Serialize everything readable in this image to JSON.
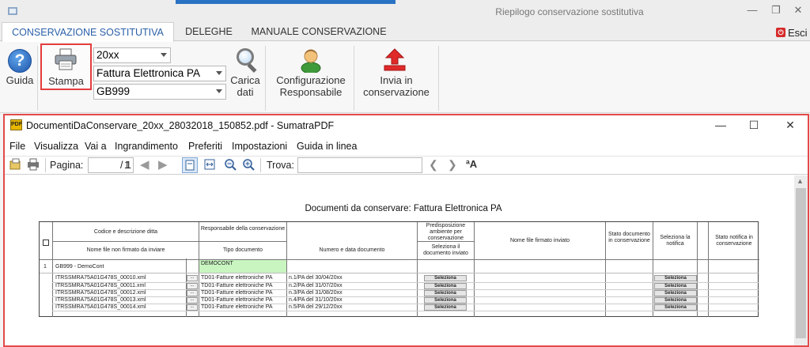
{
  "window": {
    "title": "Riepilogo conservazione sostitutiva"
  },
  "tabs": [
    {
      "label": "CONSERVAZIONE SOSTITUTIVA"
    },
    {
      "label": "DELEGHE"
    },
    {
      "label": "MANUALE CONSERVAZIONE"
    }
  ],
  "exit": {
    "label": "Esci"
  },
  "ribbon": {
    "guida": "Guida",
    "stampa": "Stampa",
    "year": "20xx",
    "doc_type": "Fattura Elettronica PA",
    "company": "GB999",
    "carica_line1": "Carica",
    "carica_line2": "dati",
    "config_line1": "Configurazione",
    "config_line2": "Responsabile",
    "invia_line1": "Invia in",
    "invia_line2": "conservazione"
  },
  "pdf": {
    "title": "DocumentiDaConservare_20xx_28032018_150852.pdf - SumatraPDF",
    "menus": [
      "File",
      "Visualizza",
      "Vai a",
      "Ingrandimento",
      "Preferiti",
      "Impostazioni",
      "Guida in linea"
    ],
    "pagina_label": "Pagina:",
    "page_value": "1",
    "page_total": "/ 1",
    "trova_label": "Trova:",
    "heading": "Documenti da conservare:  Fattura Elettronica PA"
  },
  "table": {
    "h_codice": "Codice e descrizione ditta",
    "h_nome_file": "Nome file non firmato da inviare",
    "h_responsabile": "Responsabile della conservazione",
    "h_tipo": "Tipo documento",
    "h_numero": "Numero e data documento",
    "h_predisposizione": "Predisposizione ambiente per conservazione",
    "h_seleziona_doc": "Seleziona il documento inviato",
    "h_nome_firmato": "Nome file firmato inviato",
    "h_stato_doc": "Stato documento in conservazione",
    "h_seleziona_notifica": "Seleziona la notifica",
    "h_stato_notifica": "Stato notifica in conservazione",
    "group_index": "1",
    "group_company": "GB999 - DemoCont",
    "group_responsabile": "DEMOCONT",
    "button_label": "Seleziona",
    "rows": [
      {
        "file": "ITRSSMRA75A01G478S_00010.xml",
        "dots": "...",
        "tipo": "TD01-Fatture elettroniche PA",
        "numero": "n.1/PA del 30/04/20xx"
      },
      {
        "file": "ITRSSMRA75A01G478S_00011.xml",
        "dots": "...",
        "tipo": "TD01-Fatture elettroniche PA",
        "numero": "n.2/PA del 31/07/20xx"
      },
      {
        "file": "ITRSSMRA75A01G478S_00012.xml",
        "dots": "...",
        "tipo": "TD01-Fatture elettroniche PA",
        "numero": "n.3/PA del 31/08/20xx"
      },
      {
        "file": "ITRSSMRA75A01G478S_00013.xml",
        "dots": "...",
        "tipo": "TD01-Fatture elettroniche PA",
        "numero": "n.4/PA del 31/10/20xx"
      },
      {
        "file": "ITRSSMRA75A01G478S_00014.xml",
        "dots": "...",
        "tipo": "TD01-Fatture elettroniche PA",
        "numero": "n.5/PA del 29/12/20xx"
      }
    ]
  },
  "colors": {
    "accent": "#2a73c4",
    "highlight": "#e53d3d",
    "green_cell": "#c8f5c0"
  }
}
